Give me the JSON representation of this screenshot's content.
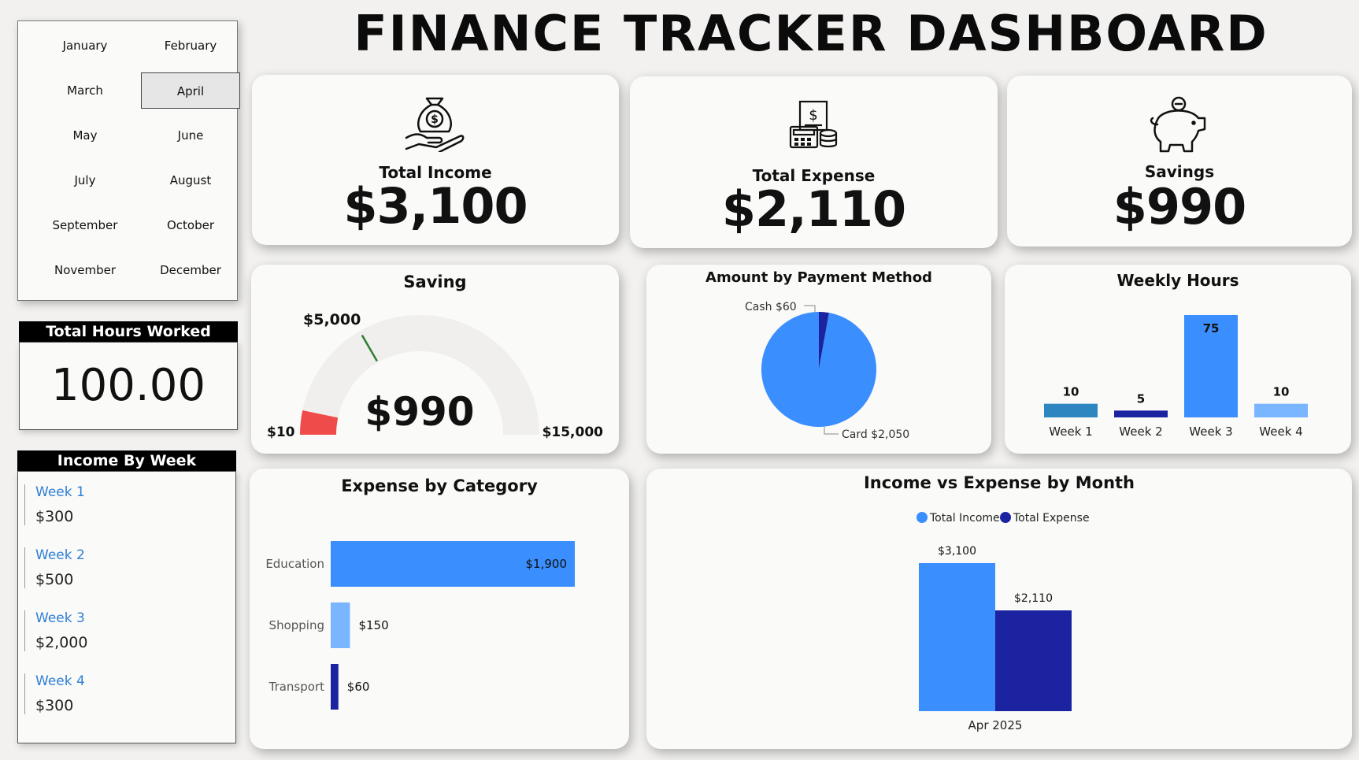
{
  "dashboard_title": "FINANCE TRACKER DASHBOARD",
  "months": [
    "January",
    "February",
    "March",
    "April",
    "May",
    "June",
    "July",
    "August",
    "September",
    "October",
    "November",
    "December"
  ],
  "selected_month": "April",
  "hours": {
    "label": "Total Hours Worked",
    "value": "100.00"
  },
  "income_by_week": {
    "label": "Income By Week",
    "items": [
      {
        "week": "Week 1",
        "amount": "$300"
      },
      {
        "week": "Week 2",
        "amount": "$500"
      },
      {
        "week": "Week 3",
        "amount": "$2,000"
      },
      {
        "week": "Week 4",
        "amount": "$300"
      }
    ]
  },
  "kpis": {
    "income": {
      "label": "Total Income",
      "value": "$3,100",
      "icon": "money-bag-hand-icon"
    },
    "expense": {
      "label": "Total Expense",
      "value": "$2,110",
      "icon": "invoice-calculator-icon"
    },
    "savings": {
      "label": "Savings",
      "value": "$990",
      "icon": "piggy-bank-icon"
    }
  },
  "colors": {
    "accent": "#3a8efd",
    "dark_blue": "#1c23a0",
    "light_blue": "#79b6ff",
    "teal_blue": "#2e86c1",
    "gauge_red": "#f04b4b",
    "gauge_bg": "#f0efee",
    "target_green": "#2e7d32"
  },
  "chart_data": [
    {
      "type": "gauge",
      "title": "Saving",
      "value": 990,
      "value_label": "$990",
      "min": 10,
      "min_label": "$10",
      "max": 15000,
      "max_label": "$15,000",
      "target": 5000,
      "target_label": "$5,000"
    },
    {
      "type": "pie",
      "title": "Amount by Payment Method",
      "slices": [
        {
          "label": "Cash $60",
          "value": 60,
          "color": "#1c23a0"
        },
        {
          "label": "Card $2,050",
          "value": 2050,
          "color": "#3a8efd"
        }
      ]
    },
    {
      "type": "bar",
      "title": "Weekly Hours",
      "categories": [
        "Week 1",
        "Week 2",
        "Week 3",
        "Week 4"
      ],
      "values": [
        10,
        5,
        75,
        10
      ],
      "colors": [
        "#2e86c1",
        "#1c23a0",
        "#3a8efd",
        "#79b6ff"
      ]
    },
    {
      "type": "bar",
      "orientation": "horizontal",
      "title": "Expense by Category",
      "categories": [
        "Education",
        "Shopping",
        "Transport"
      ],
      "values": [
        1900,
        150,
        60
      ],
      "value_labels": [
        "$1,900",
        "$150",
        "$60"
      ],
      "colors": [
        "#3a8efd",
        "#79b6ff",
        "#1c23a0"
      ]
    },
    {
      "type": "bar",
      "title": "Income vs Expense by Month",
      "categories": [
        "Apr 2025"
      ],
      "legend": "top-center",
      "series": [
        {
          "name": "Total Income",
          "values": [
            3100
          ],
          "value_labels": [
            "$3,100"
          ],
          "color": "#3a8efd"
        },
        {
          "name": "Total Expense",
          "values": [
            2110
          ],
          "value_labels": [
            "$2,110"
          ],
          "color": "#1c23a0"
        }
      ]
    }
  ]
}
